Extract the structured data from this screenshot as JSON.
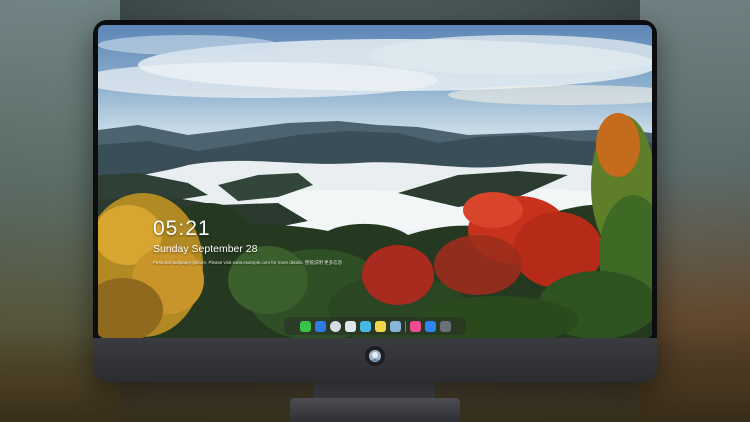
{
  "lock_screen": {
    "time": "05:21",
    "date": "Sunday September  28",
    "notice": "Personal wallpaper picture. Please visit www.example.com for more details. 壁纸说明  更多信息"
  },
  "dock": {
    "apps": [
      {
        "name": "messages-icon",
        "glyph": "▬",
        "color": "#3ac34b"
      },
      {
        "name": "finder-icon",
        "glyph": "◧",
        "color": "#2f7be6"
      },
      {
        "name": "safari-icon",
        "glyph": "◎",
        "color": "#d9dde2"
      },
      {
        "name": "photos-icon",
        "glyph": "✿",
        "color": "#dfe6ec"
      },
      {
        "name": "clapper-icon",
        "glyph": "▤",
        "color": "#46b8e6"
      },
      {
        "name": "notes-icon",
        "glyph": "▭",
        "color": "#f2d64a"
      },
      {
        "name": "preview-icon",
        "glyph": "▣",
        "color": "#89b6d8"
      },
      {
        "name": "music-icon",
        "glyph": "♪",
        "color": "#f04b8f"
      },
      {
        "name": "app-store-icon",
        "glyph": "A",
        "color": "#2c88f0"
      },
      {
        "name": "camera-icon",
        "glyph": "◉",
        "color": "#6a6f78"
      }
    ]
  },
  "colors": {
    "bezel": "#0d0d0f",
    "chin": "#34353a",
    "accent_red": "#d8331f",
    "accent_yellow": "#d8a02a"
  }
}
